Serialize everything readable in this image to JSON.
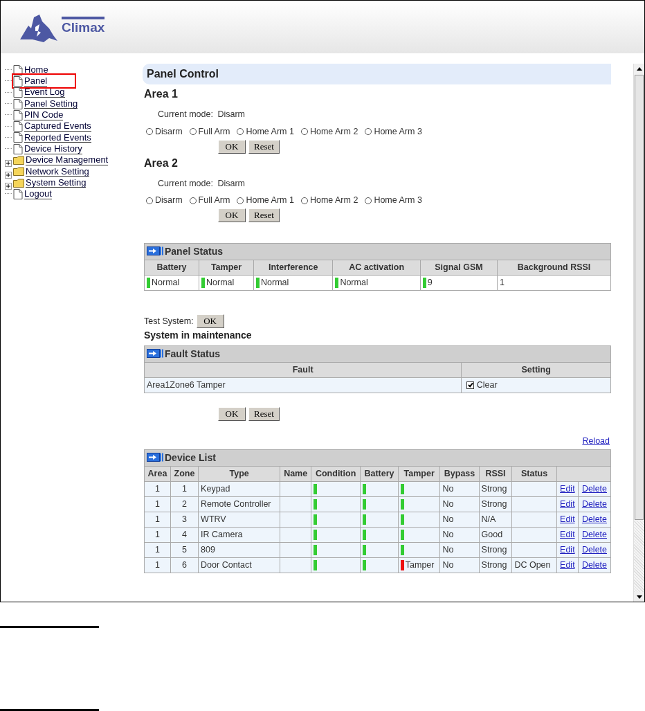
{
  "header": {
    "logo_text": "Climax"
  },
  "nav": [
    {
      "label": "Home",
      "kind": "page",
      "highlighted": false
    },
    {
      "label": "Panel",
      "kind": "page",
      "highlighted": true
    },
    {
      "label": "Event Log",
      "kind": "page",
      "highlighted": false
    },
    {
      "label": "Panel Setting",
      "kind": "page",
      "highlighted": false
    },
    {
      "label": "PIN Code",
      "kind": "page",
      "highlighted": false
    },
    {
      "label": "Captured Events",
      "kind": "page",
      "highlighted": false
    },
    {
      "label": "Reported Events",
      "kind": "page",
      "highlighted": false
    },
    {
      "label": "Device History",
      "kind": "page",
      "highlighted": false
    },
    {
      "label": "Device Management",
      "kind": "folder",
      "highlighted": false
    },
    {
      "label": "Network Setting",
      "kind": "folder",
      "highlighted": false
    },
    {
      "label": "System Setting",
      "kind": "folder",
      "highlighted": false
    },
    {
      "label": "Logout",
      "kind": "page",
      "highlighted": false
    }
  ],
  "page_title": "Panel Control",
  "areas": [
    {
      "title": "Area 1",
      "mode_label": "Current mode:",
      "mode_value": "Disarm",
      "options": [
        {
          "label": "Disarm",
          "selected": false
        },
        {
          "label": "Full Arm",
          "selected": false
        },
        {
          "label": "Home Arm 1",
          "selected": false
        },
        {
          "label": "Home Arm 2",
          "selected": false
        },
        {
          "label": "Home Arm 3",
          "selected": false
        }
      ],
      "buttons": [
        "OK",
        "Reset"
      ]
    },
    {
      "title": "Area 2",
      "mode_label": "Current mode:",
      "mode_value": "Disarm",
      "options": [
        {
          "label": "Disarm",
          "selected": false
        },
        {
          "label": "Full Arm",
          "selected": false
        },
        {
          "label": "Home Arm 1",
          "selected": false
        },
        {
          "label": "Home Arm 2",
          "selected": false
        },
        {
          "label": "Home Arm 3",
          "selected": false
        }
      ],
      "buttons": [
        "OK",
        "Reset"
      ]
    }
  ],
  "panel_status": {
    "title": "Panel Status",
    "columns": [
      "Battery",
      "Tamper",
      "Interference",
      "AC activation",
      "Signal GSM",
      "Background RSSI"
    ],
    "cells": [
      {
        "text": "Normal",
        "color": "#33cc33"
      },
      {
        "text": "Normal",
        "color": "#33cc33"
      },
      {
        "text": "Normal",
        "color": "#33cc33"
      },
      {
        "text": "Normal",
        "color": "#33cc33"
      },
      {
        "text": "9",
        "color": "#33cc33"
      },
      {
        "text": "1"
      }
    ]
  },
  "test_system": {
    "label": "Test System:",
    "button": "OK"
  },
  "maintenance": "System in maintenance",
  "fault_status": {
    "title": "Fault Status",
    "columns": [
      "Fault",
      "Setting"
    ],
    "rows": [
      {
        "fault": "Area1Zone6 Tamper",
        "setting": "Clear",
        "checked": true
      }
    ],
    "buttons": [
      "OK",
      "Reset"
    ]
  },
  "reload": "Reload",
  "device_list": {
    "title": "Device List",
    "columns": [
      "Area",
      "Zone",
      "Type",
      "Name",
      "Condition",
      "Battery",
      "Tamper",
      "Bypass",
      "RSSI",
      "Status"
    ],
    "rows": [
      {
        "area": "1",
        "zone": "1",
        "type": "Keypad",
        "condition": {
          "color": "#33cc33"
        },
        "battery": {
          "color": "#33cc33"
        },
        "tamper": {
          "color": "#33cc33"
        },
        "bypass": "No",
        "rssi": "Strong",
        "actions": [
          "Edit",
          "Delete"
        ]
      },
      {
        "area": "1",
        "zone": "2",
        "type": "Remote Controller",
        "condition": {
          "color": "#33cc33"
        },
        "battery": {
          "color": "#33cc33"
        },
        "tamper": {
          "color": "#33cc33"
        },
        "bypass": "No",
        "rssi": "Strong",
        "actions": [
          "Edit",
          "Delete"
        ]
      },
      {
        "area": "1",
        "zone": "3",
        "type": "WTRV",
        "condition": {
          "color": "#33cc33"
        },
        "battery": {
          "color": "#33cc33"
        },
        "tamper": {
          "color": "#33cc33"
        },
        "bypass": "No",
        "rssi": "N/A",
        "actions": [
          "Edit",
          "Delete"
        ]
      },
      {
        "area": "1",
        "zone": "4",
        "type": "IR Camera",
        "condition": {
          "color": "#33cc33"
        },
        "battery": {
          "color": "#33cc33"
        },
        "tamper": {
          "color": "#33cc33"
        },
        "bypass": "No",
        "rssi": "Good",
        "actions": [
          "Edit",
          "Delete"
        ]
      },
      {
        "area": "1",
        "zone": "5",
        "type": "809",
        "condition": {
          "color": "#33cc33"
        },
        "battery": {
          "color": "#33cc33"
        },
        "tamper": {
          "color": "#33cc33"
        },
        "bypass": "No",
        "rssi": "Strong",
        "actions": [
          "Edit",
          "Delete"
        ]
      },
      {
        "area": "1",
        "zone": "6",
        "type": "Door Contact",
        "condition": {
          "color": "#33cc33"
        },
        "battery": {
          "color": "#33cc33"
        },
        "tamper": {
          "color": "#ee1111",
          "text": "Tamper"
        },
        "bypass": "No",
        "rssi": "Strong",
        "status": "DC Open",
        "actions": [
          "Edit",
          "Delete"
        ]
      }
    ]
  }
}
